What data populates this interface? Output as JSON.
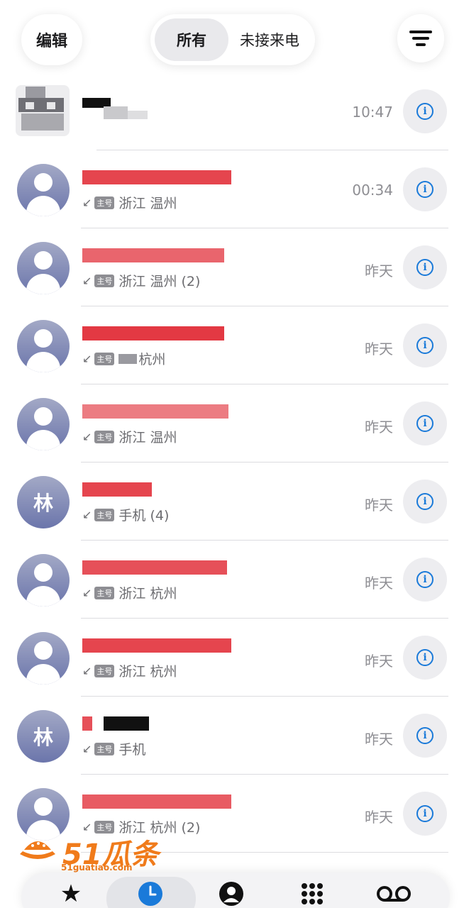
{
  "topbar": {
    "edit_label": "编辑",
    "segments": [
      "所有",
      "未接来电"
    ],
    "selected_segment": "所有",
    "filter_icon": "filter-lines-icon"
  },
  "calls": [
    {
      "avatar": "pixelated",
      "subtitle": "",
      "badge": "",
      "time": "10:47"
    },
    {
      "avatar": "person",
      "subtitle": "浙江 温州",
      "badge": "主号",
      "time": "00:34"
    },
    {
      "avatar": "person",
      "subtitle": "浙江 温州 (2)",
      "badge": "主号",
      "time": "昨天"
    },
    {
      "avatar": "person",
      "subtitle": "杭州",
      "badge": "主号",
      "time": "昨天"
    },
    {
      "avatar": "person",
      "subtitle": "浙江 温州",
      "badge": "主号",
      "time": "昨天"
    },
    {
      "avatar": "林",
      "subtitle": "手机 (4)",
      "badge": "主号",
      "time": "昨天"
    },
    {
      "avatar": "person",
      "subtitle": "浙江 杭州",
      "badge": "主号",
      "time": "昨天"
    },
    {
      "avatar": "person",
      "subtitle": "浙江 杭州",
      "badge": "主号",
      "time": "昨天"
    },
    {
      "avatar": "林",
      "subtitle": "手机",
      "badge": "主号",
      "time": "昨天"
    },
    {
      "avatar": "person",
      "subtitle": "浙江 杭州 (2)",
      "badge": "主号",
      "time": "昨天"
    }
  ],
  "info_icon": "i",
  "watermark": {
    "brand": "51瓜条",
    "url": "51guatiao.com"
  },
  "tabbar": {
    "items": [
      "favorites-star-icon",
      "recents-clock-icon",
      "contacts-person-icon",
      "keypad-grid-icon",
      "voicemail-icon"
    ],
    "active": "recents-clock-icon"
  },
  "colors": {
    "accent": "#1a7ad9",
    "redacted": "#e0242f",
    "watermark": "#f07b1b"
  }
}
